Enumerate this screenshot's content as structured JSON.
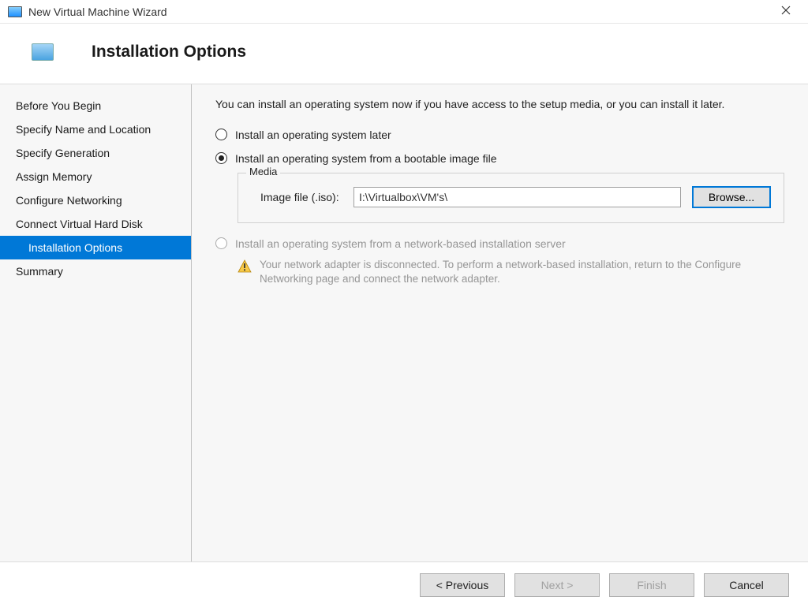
{
  "window": {
    "title": "New Virtual Machine Wizard"
  },
  "header": {
    "title": "Installation Options"
  },
  "sidebar": {
    "items": [
      {
        "label": "Before You Begin",
        "selected": false
      },
      {
        "label": "Specify Name and Location",
        "selected": false
      },
      {
        "label": "Specify Generation",
        "selected": false
      },
      {
        "label": "Assign Memory",
        "selected": false
      },
      {
        "label": "Configure Networking",
        "selected": false
      },
      {
        "label": "Connect Virtual Hard Disk",
        "selected": false
      },
      {
        "label": "Installation Options",
        "selected": true
      },
      {
        "label": "Summary",
        "selected": false
      }
    ]
  },
  "content": {
    "intro": "You can install an operating system now if you have access to the setup media, or you can install it later.",
    "options": {
      "later": {
        "label": "Install an operating system later",
        "checked": false,
        "enabled": true
      },
      "bootable_image": {
        "label": "Install an operating system from a bootable image file",
        "checked": true,
        "enabled": true
      },
      "network_install": {
        "label": "Install an operating system from a network-based installation server",
        "checked": false,
        "enabled": false
      }
    },
    "media": {
      "legend": "Media",
      "image_file_label": "Image file (.iso):",
      "image_file_value": "I:\\Virtualbox\\VM's\\",
      "browse_label": "Browse..."
    },
    "warning": "Your network adapter is disconnected. To perform a network-based installation, return to the Configure Networking page and connect the network adapter."
  },
  "buttons": {
    "previous": "< Previous",
    "next": "Next >",
    "finish": "Finish",
    "cancel": "Cancel"
  }
}
